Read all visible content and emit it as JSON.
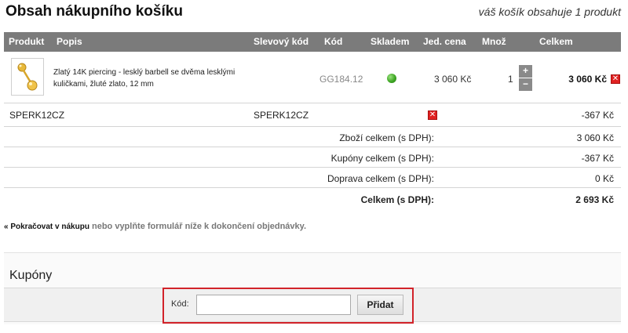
{
  "page": {
    "title": "Obsah nákupního košíku",
    "cart_count_text": "váš košík obsahuje 1 produkt"
  },
  "table": {
    "headers": [
      "Produkt",
      "Popis",
      "Slevový kód",
      "Kód",
      "Skladem",
      "Jed. cena",
      "Množ",
      "Celkem"
    ]
  },
  "product": {
    "description": "Zlatý 14K piercing - lesklý barbell se dvěma lesklými kuličkami, žluté zlato, 12 mm",
    "code": "GG184.12",
    "stock_color": "#3ea624",
    "unit_price": "3 060 Kč",
    "quantity": "1",
    "plus_label": "+",
    "minus_label": "−",
    "total": "3 060 Kč",
    "remove_label": "✕"
  },
  "coupon_line": {
    "name": "SPERK12CZ",
    "code": "SPERK12CZ",
    "remove_label": "✕",
    "amount": "-367 Kč"
  },
  "summary": [
    {
      "label": "Zboží celkem (s DPH):",
      "value": "3 060 Kč"
    },
    {
      "label": "Kupóny celkem (s DPH):",
      "value": "-367 Kč"
    },
    {
      "label": "Doprava celkem (s DPH):",
      "value": "0 Kč"
    },
    {
      "label": "Celkem (s DPH):",
      "value": "2 693 Kč"
    }
  ],
  "continue": {
    "link_text": "« Pokračovat v nákupu",
    "rest_text": " nebo vyplňte formulář níže k dokončení objednávky."
  },
  "coupons": {
    "heading": "Kupóny",
    "code_label": "Kód:",
    "input_value": "",
    "input_placeholder": "",
    "add_button": "Přidat"
  },
  "colors": {
    "header_bg": "#7b7b7b",
    "highlight_border": "#d2232a",
    "remove_red": "#e02121"
  }
}
